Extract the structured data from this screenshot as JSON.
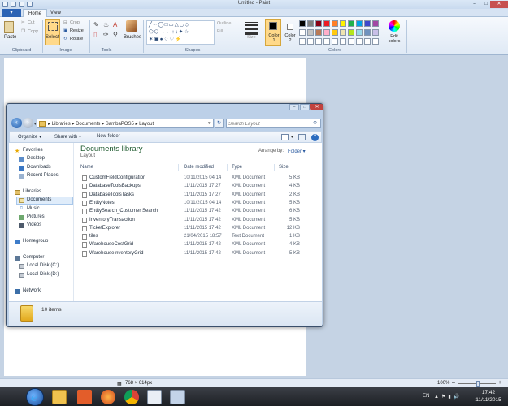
{
  "paint": {
    "title": "Untitled - Paint",
    "tabs": [
      "Home",
      "View"
    ],
    "app_menu": "▾",
    "groups": {
      "clipboard": {
        "label": "Clipboard",
        "paste": "Paste",
        "cut": "Cut",
        "copy": "Copy"
      },
      "image": {
        "label": "Image",
        "select": "Select",
        "crop": "Crop",
        "resize": "Resize",
        "rotate": "Rotate"
      },
      "tools": {
        "label": "Tools"
      },
      "brushes": {
        "label": "Brushes"
      },
      "shapes": {
        "label": "Shapes",
        "outline": "Outline",
        "fill": "Fill"
      },
      "size": {
        "label": "Size"
      },
      "colors": {
        "label": "Colors",
        "color1": "Color 1",
        "color2": "Color 2",
        "edit": "Edit colors",
        "palette_row1": [
          "#000000",
          "#7f7f7f",
          "#880015",
          "#ed1c24",
          "#ff7f27",
          "#fff200",
          "#22b14c",
          "#00a2e8",
          "#3f48cc",
          "#a349a4"
        ],
        "palette_row2": [
          "#ffffff",
          "#c3c3c3",
          "#b97a57",
          "#ffaec9",
          "#ffc90e",
          "#efe4b0",
          "#b5e61d",
          "#99d9ea",
          "#7092be",
          "#c8bfe7"
        ]
      }
    },
    "status": {
      "dims": "768 × 614px",
      "zoom": "100%"
    }
  },
  "explorer": {
    "address": [
      "Libraries",
      "Documents",
      "SambaPOS5",
      "Layout"
    ],
    "search_placeholder": "Search Layout",
    "toolbar": {
      "organize": "Organize ▾",
      "share": "Share with ▾",
      "new_folder": "New folder"
    },
    "nav": {
      "favorites": "Favorites",
      "favorites_items": [
        "Desktop",
        "Downloads",
        "Recent Places"
      ],
      "libraries": "Libraries",
      "libraries_items": [
        "Documents",
        "Music",
        "Pictures",
        "Videos"
      ],
      "homegroup": "Homegroup",
      "computer": "Computer",
      "computer_items": [
        "Local Disk (C:)",
        "Local Disk (D:)"
      ],
      "network": "Network"
    },
    "library_title": "Documents library",
    "library_sub": "Layout",
    "arrange_by_label": "Arrange by:",
    "arrange_by_value": "Folder ▾",
    "columns": [
      "Name",
      "Date modified",
      "Type",
      "Size"
    ],
    "files": [
      {
        "name": "CustomFieldConfiguration",
        "date": "10/11/2015 04:14",
        "type": "XML Document",
        "size": "5 KB"
      },
      {
        "name": "DatabaseToolsBackups",
        "date": "11/11/2015 17:27",
        "type": "XML Document",
        "size": "4 KB"
      },
      {
        "name": "DatabaseToolsTasks",
        "date": "11/11/2015 17:27",
        "type": "XML Document",
        "size": "2 KB"
      },
      {
        "name": "EntityNotes",
        "date": "10/11/2015 04:14",
        "type": "XML Document",
        "size": "5 KB"
      },
      {
        "name": "EntitySearch_Customer Search",
        "date": "11/11/2015 17:42",
        "type": "XML Document",
        "size": "6 KB"
      },
      {
        "name": "InventoryTransaction",
        "date": "11/11/2015 17:42",
        "type": "XML Document",
        "size": "5 KB"
      },
      {
        "name": "TicketExplorer",
        "date": "11/11/2015 17:42",
        "type": "XML Document",
        "size": "12 KB"
      },
      {
        "name": "tiles",
        "date": "21/04/2015 18:57",
        "type": "Text Document",
        "size": "1 KB"
      },
      {
        "name": "WarehouseCostGrid",
        "date": "11/11/2015 17:42",
        "type": "XML Document",
        "size": "4 KB"
      },
      {
        "name": "WarehouseInventoryGrid",
        "date": "11/11/2015 17:42",
        "type": "XML Document",
        "size": "5 KB"
      }
    ],
    "item_count": "10 items"
  },
  "taskbar": {
    "time": "17:42",
    "date": "11/11/2015",
    "lang": "EN"
  }
}
